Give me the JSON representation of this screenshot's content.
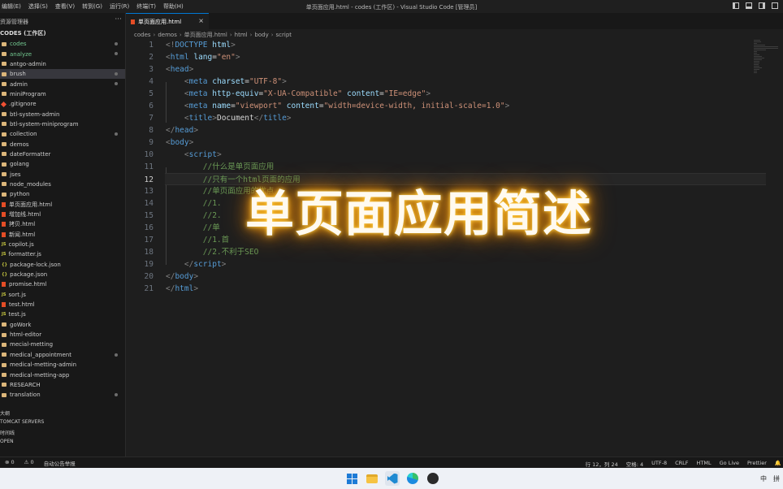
{
  "window": {
    "title": "单页面应用.html - codes (工作区) - Visual Studio Code [管理员]",
    "menu": [
      "编辑(E)",
      "选择(S)",
      "查看(V)",
      "转到(G)",
      "运行(R)",
      "终端(T)",
      "帮助(H)"
    ]
  },
  "sidebar": {
    "header": "资源管理器",
    "more_icon": "ellipsis-icon",
    "workspace_title": "CODES (工作区)",
    "items": [
      {
        "label": "codes",
        "icon": "folder",
        "status": "green",
        "dot": true
      },
      {
        "label": "analyze",
        "icon": "folder",
        "status": "green",
        "dot": true
      },
      {
        "label": "antgo-admin",
        "icon": "folder"
      },
      {
        "label": "brush",
        "icon": "folder",
        "selected": true,
        "dot": true
      },
      {
        "label": "admin",
        "icon": "folder",
        "dot": true
      },
      {
        "label": "miniProgram",
        "icon": "folder"
      },
      {
        "label": ".gitignore",
        "icon": "git"
      },
      {
        "label": "btl-system-admin",
        "icon": "folder"
      },
      {
        "label": "btl-system-miniprogram",
        "icon": "folder"
      },
      {
        "label": "collection",
        "icon": "folder",
        "dot": true
      },
      {
        "label": "demos",
        "icon": "folder"
      },
      {
        "label": "dateFormatter",
        "icon": "folder"
      },
      {
        "label": "golang",
        "icon": "folder"
      },
      {
        "label": "jses",
        "icon": "folder"
      },
      {
        "label": "node_modules",
        "icon": "folder"
      },
      {
        "label": "python",
        "icon": "folder"
      },
      {
        "label": "单页面应用.html",
        "icon": "html5"
      },
      {
        "label": "增加线.html",
        "icon": "html5"
      },
      {
        "label": "拷贝.html",
        "icon": "html5"
      },
      {
        "label": "新闻.html",
        "icon": "html5"
      },
      {
        "label": "copilot.js",
        "icon": "js"
      },
      {
        "label": "formatter.js",
        "icon": "js"
      },
      {
        "label": "package-lock.json",
        "icon": "json"
      },
      {
        "label": "package.json",
        "icon": "json"
      },
      {
        "label": "promise.html",
        "icon": "html5"
      },
      {
        "label": "sort.js",
        "icon": "js"
      },
      {
        "label": "test.html",
        "icon": "html5"
      },
      {
        "label": "test.js",
        "icon": "js"
      },
      {
        "label": "goWork",
        "icon": "folder"
      },
      {
        "label": "html-editor",
        "icon": "folder"
      },
      {
        "label": "mecial-metting",
        "icon": "folder"
      },
      {
        "label": "medical_appointment",
        "icon": "folder",
        "dot": true
      },
      {
        "label": "medical-metting-admin",
        "icon": "folder"
      },
      {
        "label": "medical-metting-app",
        "icon": "folder"
      },
      {
        "label": "RESEARCH",
        "icon": "folder"
      },
      {
        "label": "translation",
        "icon": "folder",
        "dot": true
      }
    ],
    "sections": [
      "大纲",
      "TOMCAT SERVERS",
      "时间线",
      "OPEN"
    ]
  },
  "editor": {
    "tab_label": "单页面应用.html",
    "breadcrumb": [
      "codes",
      "demos",
      "单页面应用.html",
      "html",
      "body",
      "script"
    ],
    "current_line": 12,
    "lines": [
      {
        "n": "1",
        "parts": [
          [
            "t-br",
            "<!"
          ],
          [
            "t-tag",
            "DOCTYPE"
          ],
          [
            "t-attr",
            " html"
          ],
          [
            "t-br",
            ">"
          ]
        ]
      },
      {
        "n": "2",
        "parts": [
          [
            "t-br",
            "<"
          ],
          [
            "t-tag",
            "html"
          ],
          [
            "t-attr",
            " lang"
          ],
          [
            "t-txt",
            "="
          ],
          [
            "t-str",
            "\"en\""
          ],
          [
            "t-br",
            ">"
          ]
        ]
      },
      {
        "n": "3",
        "parts": [
          [
            "t-br",
            "<"
          ],
          [
            "t-tag",
            "head"
          ],
          [
            "t-br",
            ">"
          ]
        ]
      },
      {
        "n": "4",
        "parts": [
          [
            "t-txt",
            "    "
          ],
          [
            "t-br",
            "<"
          ],
          [
            "t-tag",
            "meta"
          ],
          [
            "t-attr",
            " charset"
          ],
          [
            "t-txt",
            "="
          ],
          [
            "t-str",
            "\"UTF-8\""
          ],
          [
            "t-br",
            ">"
          ]
        ]
      },
      {
        "n": "5",
        "parts": [
          [
            "t-txt",
            "    "
          ],
          [
            "t-br",
            "<"
          ],
          [
            "t-tag",
            "meta"
          ],
          [
            "t-attr",
            " http-equiv"
          ],
          [
            "t-txt",
            "="
          ],
          [
            "t-str",
            "\"X-UA-Compatible\""
          ],
          [
            "t-attr",
            " content"
          ],
          [
            "t-txt",
            "="
          ],
          [
            "t-str",
            "\"IE=edge\""
          ],
          [
            "t-br",
            ">"
          ]
        ]
      },
      {
        "n": "6",
        "parts": [
          [
            "t-txt",
            "    "
          ],
          [
            "t-br",
            "<"
          ],
          [
            "t-tag",
            "meta"
          ],
          [
            "t-attr",
            " name"
          ],
          [
            "t-txt",
            "="
          ],
          [
            "t-str",
            "\"viewport\""
          ],
          [
            "t-attr",
            " content"
          ],
          [
            "t-txt",
            "="
          ],
          [
            "t-str",
            "\"width=device-width, initial-scale=1.0\""
          ],
          [
            "t-br",
            ">"
          ]
        ]
      },
      {
        "n": "7",
        "parts": [
          [
            "t-txt",
            "    "
          ],
          [
            "t-br",
            "<"
          ],
          [
            "t-tag",
            "title"
          ],
          [
            "t-br",
            ">"
          ],
          [
            "t-txt",
            "Document"
          ],
          [
            "t-br",
            "</"
          ],
          [
            "t-tag",
            "title"
          ],
          [
            "t-br",
            ">"
          ]
        ]
      },
      {
        "n": "8",
        "parts": [
          [
            "t-br",
            "</"
          ],
          [
            "t-tag",
            "head"
          ],
          [
            "t-br",
            ">"
          ]
        ]
      },
      {
        "n": "9",
        "parts": [
          [
            "t-br",
            "<"
          ],
          [
            "t-tag",
            "body"
          ],
          [
            "t-br",
            ">"
          ]
        ]
      },
      {
        "n": "10",
        "parts": [
          [
            "t-txt",
            "    "
          ],
          [
            "t-br",
            "<"
          ],
          [
            "t-tag",
            "script"
          ],
          [
            "t-br",
            ">"
          ]
        ]
      },
      {
        "n": "11",
        "parts": [
          [
            "t-com",
            "        //什么是单页面应用"
          ]
        ]
      },
      {
        "n": "12",
        "parts": [
          [
            "t-com",
            "        //只有一个html页面的应用"
          ]
        ]
      },
      {
        "n": "13",
        "parts": [
          [
            "t-com",
            "        //单页面应用的优点"
          ]
        ]
      },
      {
        "n": "14",
        "parts": [
          [
            "t-com",
            "        //1."
          ]
        ]
      },
      {
        "n": "15",
        "parts": [
          [
            "t-com",
            "        //2."
          ]
        ]
      },
      {
        "n": "16",
        "parts": [
          [
            "t-com",
            "        //单"
          ]
        ]
      },
      {
        "n": "17",
        "parts": [
          [
            "t-com",
            "        //1.首"
          ]
        ]
      },
      {
        "n": "18",
        "parts": [
          [
            "t-com",
            "        //2.不利于SEO"
          ]
        ]
      },
      {
        "n": "19",
        "parts": [
          [
            "t-txt",
            "    "
          ],
          [
            "t-br",
            "</"
          ],
          [
            "t-tag",
            "script"
          ],
          [
            "t-br",
            ">"
          ]
        ]
      },
      {
        "n": "20",
        "parts": [
          [
            "t-br",
            "</"
          ],
          [
            "t-tag",
            "body"
          ],
          [
            "t-br",
            ">"
          ]
        ]
      },
      {
        "n": "21",
        "parts": [
          [
            "t-br",
            "</"
          ],
          [
            "t-tag",
            "html"
          ],
          [
            "t-br",
            ">"
          ]
        ]
      }
    ]
  },
  "overlay_title": "单页面应用简述",
  "statusbar": {
    "errors": "⊗ 0",
    "warnings": "⚠ 0",
    "left_extra": "自动公告举报",
    "position": "行 12，列 24",
    "spaces": "空格: 4",
    "encoding": "UTF-8",
    "eol": "CRLF",
    "language": "HTML",
    "golive": "Go Live",
    "prettier": "Prettier"
  },
  "taskbar": {
    "icons": [
      "windows-start-icon",
      "file-explorer-icon",
      "vscode-icon",
      "edge-icon",
      "app-icon"
    ],
    "ime": "中",
    "input_mode": "拼"
  }
}
